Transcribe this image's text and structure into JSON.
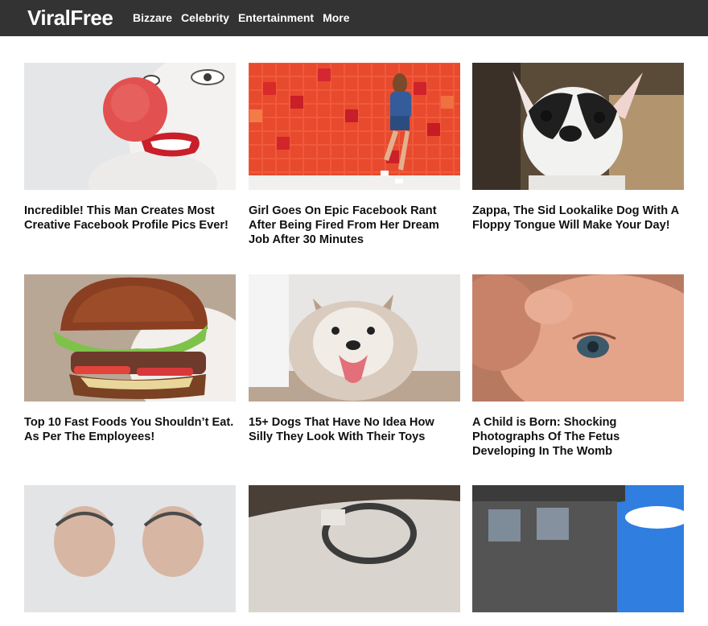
{
  "site": {
    "brand": "ViralFree"
  },
  "nav": {
    "items": [
      "Bizzare",
      "Celebrity",
      "Entertainment",
      "More"
    ]
  },
  "cards": [
    {
      "title": "Incredible! This Man Creates Most Creative Facebook Profile Pics Ever!",
      "image": "clown-face-red-nose"
    },
    {
      "title": "Girl Goes On Epic Facebook Rant After Being Fired From Her Dream Job After 30 Minutes",
      "image": "woman-red-tile-wall"
    },
    {
      "title": "Zappa, The Sid Lookalike Dog With A Floppy Tongue Will Make Your Day!",
      "image": "french-bulldog-puppy"
    },
    {
      "title": "Top 10 Fast Foods You Shouldn’t Eat. As Per The Employees!",
      "image": "burger"
    },
    {
      "title": "15+ Dogs That Have No Idea How Silly They Look With Their Toys",
      "image": "fluffy-husky"
    },
    {
      "title": "A Child is Born: Shocking Photographs Of The Fetus Developing In The Womb",
      "image": "baby-closeup"
    },
    {
      "title": "",
      "image": "two-bald-men"
    },
    {
      "title": "",
      "image": "car-interior-steering-wheel"
    },
    {
      "title": "",
      "image": "modern-building-sky"
    }
  ]
}
